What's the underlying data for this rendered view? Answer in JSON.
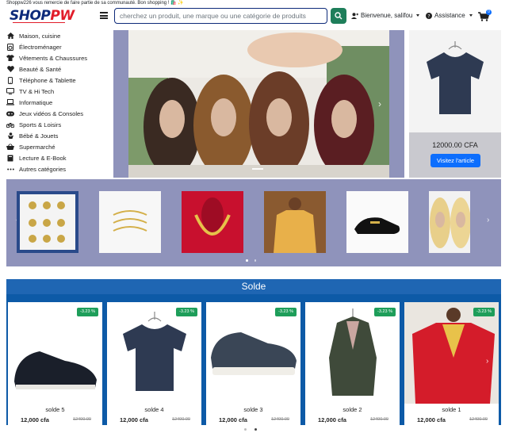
{
  "banner": {
    "text": "Shoppw226 vous remercie de faire partie de sa communauté. Bon shopping ! 🛍️ ✨"
  },
  "header": {
    "logo_main": "SHOP",
    "logo_accent": "PW",
    "search_placeholder": "cherchez un produit, une marque ou une catégorie de produits",
    "user_label": "Bienvenue, salifou",
    "assist_label": "Assistance",
    "cart_count": "0"
  },
  "sidebar": {
    "items": [
      {
        "label": "Maison, cuisine",
        "icon": "home-icon"
      },
      {
        "label": "Électroménager",
        "icon": "appliance-icon"
      },
      {
        "label": "Vêtements & Chaussures",
        "icon": "shirt-icon"
      },
      {
        "label": "Beauté & Santé",
        "icon": "heart-icon"
      },
      {
        "label": "Téléphone & Tablette",
        "icon": "phone-icon"
      },
      {
        "label": "TV & Hi Tech",
        "icon": "tv-icon"
      },
      {
        "label": "Informatique",
        "icon": "laptop-icon"
      },
      {
        "label": "Jeux vidéos & Consoles",
        "icon": "gamepad-icon"
      },
      {
        "label": "Sports & Loisirs",
        "icon": "bicycle-icon"
      },
      {
        "label": "Bébé & Jouets",
        "icon": "baby-icon"
      },
      {
        "label": "Supermarché",
        "icon": "basket-icon"
      },
      {
        "label": "Lecture & E-Book",
        "icon": "book-icon"
      },
      {
        "label": "Autres catégories",
        "icon": "ellipsis-icon"
      }
    ]
  },
  "featured": {
    "price": "12000.00 CFA",
    "button": "Visitez l'article"
  },
  "solde": {
    "title": "Solde",
    "items": [
      {
        "name": "solde 5",
        "price": "12,000 cfa",
        "old": "12400.00",
        "badge": "-3.23 %"
      },
      {
        "name": "solde 4",
        "price": "12,000 cfa",
        "old": "12400.00",
        "badge": "-3.23 %"
      },
      {
        "name": "solde 3",
        "price": "12,000 cfa",
        "old": "12400.00",
        "badge": "-3.23 %"
      },
      {
        "name": "solde 2",
        "price": "12,000 cfa",
        "old": "12400.00",
        "badge": "-3.23 %"
      },
      {
        "name": "solde 1",
        "price": "12,000 cfa",
        "old": "12400.00",
        "badge": "-3.23 %"
      }
    ]
  },
  "colors": {
    "brand_navy": "#0d2a7a",
    "brand_red": "#e11d2a",
    "carousel_bg": "#8f93bb",
    "solde_bg": "#0d5aa7",
    "badge_green": "#1e9e5a",
    "button_blue": "#0d6efd"
  }
}
